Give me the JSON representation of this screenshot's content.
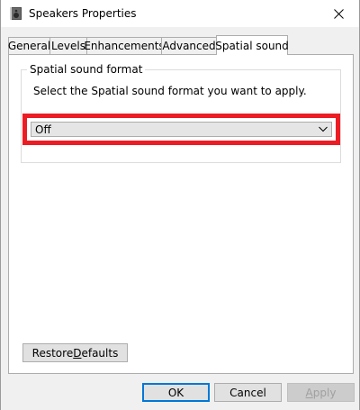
{
  "window": {
    "title": "Speakers Properties",
    "title_icon": "speaker-icon",
    "close_icon": "close-icon"
  },
  "tabs": [
    {
      "label": "General"
    },
    {
      "label": "Levels"
    },
    {
      "label": "Enhancements"
    },
    {
      "label": "Advanced"
    },
    {
      "label": "Spatial sound",
      "active": true
    }
  ],
  "spatial": {
    "group_title": "Spatial sound format",
    "description": "Select the Spatial sound format you want to apply.",
    "format_value": "Off",
    "highlight_color": "#ec1c24"
  },
  "buttons": {
    "restore_pre": "Restore ",
    "restore_accel": "D",
    "restore_post": "efaults",
    "ok": "OK",
    "cancel": "Cancel",
    "apply_accel": "A",
    "apply_post": "pply"
  },
  "colors": {
    "accent": "#0078d7"
  }
}
